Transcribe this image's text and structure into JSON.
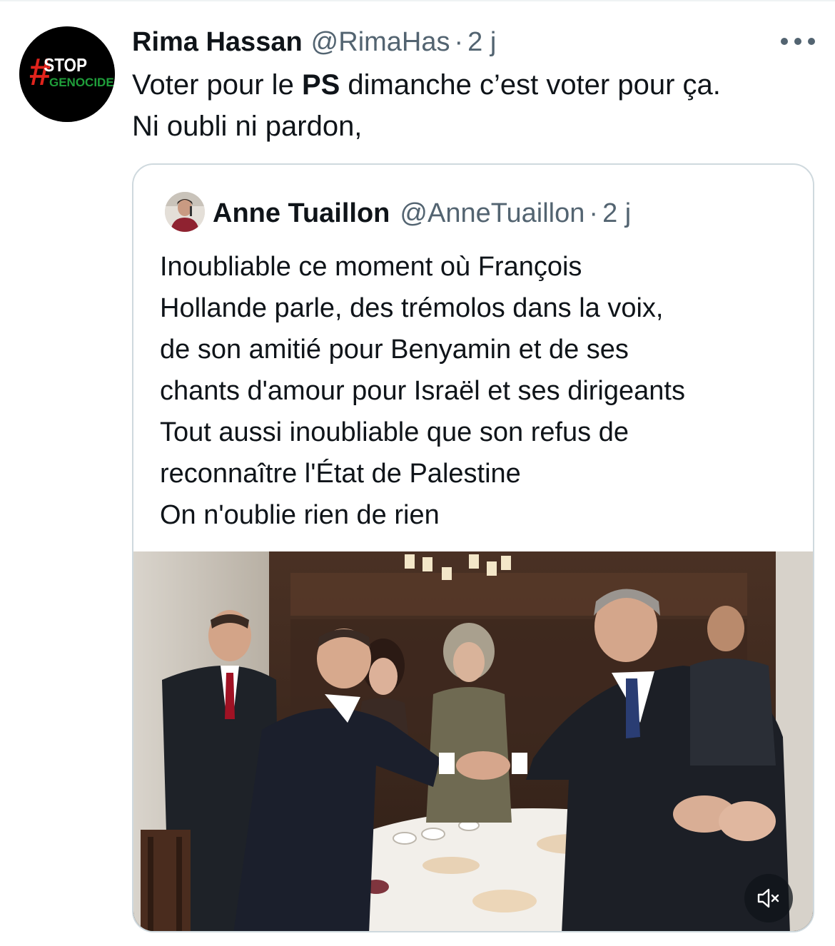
{
  "tweet": {
    "author_name": "Rima Hassan",
    "author_handle": "@RimaHas",
    "separator": "·",
    "time": "2 j",
    "avatar_text_top": "STOP",
    "avatar_text_bottom": "GENOCIDE",
    "avatar_hash": "#",
    "text_line1_before": "Voter pour le ",
    "text_line1_bold": "PS",
    "text_line1_after": " dimanche c’est voter pour ça.",
    "text_line2": "Ni oubli ni pardon,"
  },
  "quoted_tweet": {
    "author_name": "Anne Tuaillon",
    "author_handle": "@AnneTuaillon",
    "separator": "·",
    "time": "2 j",
    "text_lines": [
      "Inoubliable ce moment où François",
      "Hollande parle, des trémolos dans la voix,",
      "de son amitié pour Benyamin et de ses",
      "chants d'amour pour Israël et ses dirigeants",
      "Tout aussi inoubliable que son refus de",
      "reconnaître l'État de Palestine",
      "On n'oublie rien de rien"
    ]
  },
  "icons": {
    "more": "more-horizontal-icon",
    "mute": "volume-muted-icon"
  },
  "colors": {
    "text_primary": "#0f1419",
    "text_secondary": "#536471",
    "border": "#cfd9de",
    "avatar_red": "#e0231c",
    "avatar_green": "#1f9e3a"
  }
}
